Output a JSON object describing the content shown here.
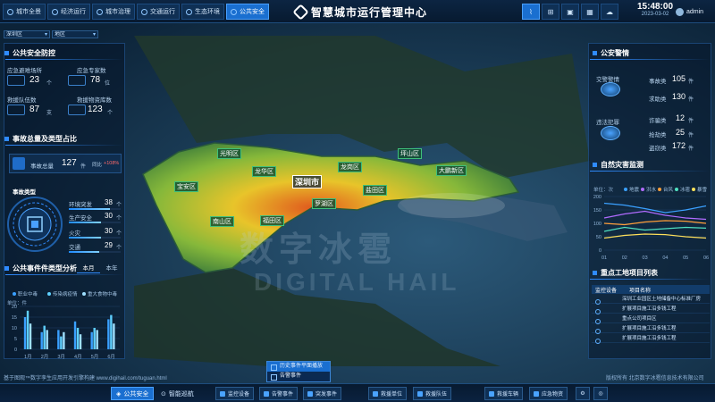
{
  "header": {
    "title": "智慧城市运行管理中心",
    "tabs": [
      {
        "label": "城市全景",
        "active": false
      },
      {
        "label": "经济运行",
        "active": false
      },
      {
        "label": "城市治理",
        "active": false
      },
      {
        "label": "交通运行",
        "active": false
      },
      {
        "label": "生态环境",
        "active": false
      },
      {
        "label": "公共安全",
        "active": true
      }
    ],
    "tools": [
      "chart-icon",
      "grid-icon",
      "image-icon",
      "calendar-icon",
      "cloud-icon"
    ],
    "time": "15:48:00",
    "date": "2023-03-02",
    "user": "admin"
  },
  "filters": {
    "region": "深圳区",
    "district": "地区"
  },
  "left": {
    "prevention": {
      "title": "公共安全防控",
      "stats": [
        {
          "label": "应急避难场所",
          "value": "23",
          "unit": "个"
        },
        {
          "label": "应急专家数",
          "value": "78",
          "unit": "位"
        },
        {
          "label": "救援队伍数",
          "value": "87",
          "unit": "支"
        },
        {
          "label": "救援物资库数",
          "value": "123",
          "unit": "个"
        }
      ]
    },
    "incidents": {
      "title": "事故总量及类型占比",
      "total_label": "事故总量",
      "total_value": "127",
      "total_unit": "件",
      "change_label": "同比",
      "change_value": "+108%",
      "type_title": "事故类型",
      "types": [
        {
          "label": "环境突发",
          "value": "38",
          "unit": "个",
          "pct": 0.8
        },
        {
          "label": "生产安全",
          "value": "30",
          "unit": "个",
          "pct": 0.62
        },
        {
          "label": "火灾",
          "value": "30",
          "unit": "个",
          "pct": 0.62
        },
        {
          "label": "交通",
          "value": "29",
          "unit": "个",
          "pct": 0.58
        }
      ]
    },
    "analysis": {
      "title": "公共事件件类型分析",
      "periods": [
        "本月",
        "本年"
      ],
      "active_period": "本月",
      "legend": [
        "职业中毒",
        "传染病疫情",
        "重大食物中毒"
      ],
      "unit_label": "单位：件",
      "y_ticks": [
        "20",
        "15",
        "10",
        "5",
        "0"
      ]
    }
  },
  "chart_data": [
    {
      "type": "bar",
      "categories": [
        "1月",
        "2月",
        "3月",
        "4月",
        "5月",
        "6月"
      ],
      "series": [
        {
          "name": "职业中毒",
          "values": [
            15,
            8,
            9,
            13,
            8,
            14
          ]
        },
        {
          "name": "传染病疫情",
          "values": [
            18,
            11,
            6,
            10,
            10,
            16
          ]
        },
        {
          "name": "重大食物中毒",
          "values": [
            12,
            9,
            8,
            7,
            9,
            12
          ]
        }
      ],
      "ylabel": "单位：件",
      "ylim": [
        0,
        20
      ]
    },
    {
      "type": "line",
      "categories": [
        "01",
        "02",
        "03",
        "04",
        "05",
        "06"
      ],
      "series": [
        {
          "name": "地震",
          "values": [
            175,
            168,
            155,
            140,
            150,
            165
          ]
        },
        {
          "name": "洪水",
          "values": [
            120,
            135,
            145,
            130,
            120,
            115
          ]
        },
        {
          "name": "台风",
          "values": [
            100,
            95,
            105,
            110,
            108,
            100
          ]
        },
        {
          "name": "冰雹",
          "values": [
            70,
            85,
            75,
            80,
            85,
            82
          ]
        },
        {
          "name": "暴雪",
          "values": [
            45,
            55,
            60,
            58,
            50,
            45
          ]
        }
      ],
      "ylabel": "单位：次",
      "y_ticks": [
        "200",
        "150",
        "100",
        "50",
        "0"
      ],
      "ylim": [
        0,
        200
      ]
    }
  ],
  "right": {
    "alarms": {
      "title": "公安警情",
      "groups": [
        {
          "label": "交警警情",
          "items": [
            {
              "label": "事故类",
              "value": "105",
              "unit": "件"
            },
            {
              "label": "求助类",
              "value": "130",
              "unit": "件"
            }
          ]
        },
        {
          "label": "违法犯罪",
          "items": [
            {
              "label": "诈骗类",
              "value": "12",
              "unit": "件"
            },
            {
              "label": "抢劫类",
              "value": "25",
              "unit": "件"
            },
            {
              "label": "盗窃类",
              "value": "172",
              "unit": "件"
            }
          ]
        }
      ]
    },
    "disaster": {
      "title": "自然灾害监测",
      "unit_label": "单位：次",
      "legend": [
        "地震",
        "洪水",
        "台风",
        "冰雹",
        "暴雪"
      ]
    },
    "projects": {
      "title": "重点工地项目列表",
      "headers": [
        "监控设备",
        "项目名称"
      ],
      "rows": [
        "深圳工业园区土地储备中心标准厂房",
        "扩展项目施工沿多钱工程",
        "重点公司项目区",
        "扩展项目施工沿多钱工程",
        "扩展项目施工沿多钱工程"
      ]
    }
  },
  "map": {
    "city": "深圳市",
    "districts": [
      "光明区",
      "龙华区",
      "宝安区",
      "龙岗区",
      "坪山区",
      "大鹏新区",
      "罗湖区",
      "福田区",
      "南山区",
      "盐田区"
    ],
    "watermark_cn": "数字冰雹",
    "watermark_en": "DIGITAL HAIL"
  },
  "popup": {
    "items": [
      "历史事件平面播放",
      "告警事件"
    ]
  },
  "bottom": {
    "left_tabs": [
      {
        "label": "公共安全",
        "active": true
      },
      {
        "label": "智能巡航",
        "active": false
      }
    ],
    "chips": [
      "监控设备",
      "告警事件",
      "突发事件",
      "救援单位",
      "救援队伍",
      "救援车辆",
      "应急物资"
    ],
    "footer_left": "基于图观™数字孪生应用开发引擎构建 www.digihail.com/tuguan.html",
    "footer_right": "版权所有 北京数字冰雹信息技术有限公司"
  },
  "colors": {
    "accent": "#1a6fd0",
    "panel_border": "#1e4d7e",
    "bar1": "#3aa0ff",
    "bar2": "#5fd0ff",
    "bar3": "#9fe0ff"
  }
}
